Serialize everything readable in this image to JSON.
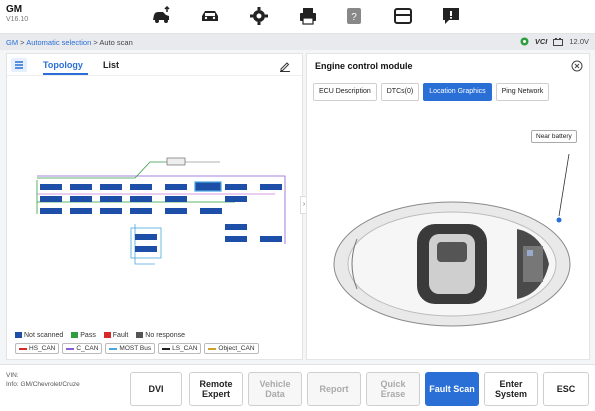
{
  "app": {
    "make": "GM",
    "version": "V16.10"
  },
  "toolbar": {
    "icons": [
      "car-upload-icon",
      "car-icon",
      "gear-icon",
      "printer-icon",
      "help-icon",
      "folder-icon",
      "feedback-icon"
    ]
  },
  "breadcrumb": {
    "part1": "GM",
    "sep1": " > ",
    "part2": "Automatic selection",
    "sep2": " > ",
    "part3": "Auto scan"
  },
  "status": {
    "vci": "VCI",
    "voltage": "12.0V"
  },
  "left_panel": {
    "tab_topology": "Topology",
    "tab_list": "List",
    "legend": {
      "not_scanned": "Not scanned",
      "pass": "Pass",
      "fault": "Fault",
      "no_response": "No response",
      "buses": [
        "HS_CAN",
        "C_CAN",
        "MOST Bus",
        "LS_CAN",
        "Object_CAN"
      ]
    }
  },
  "right_panel": {
    "title": "Engine control module",
    "tabs": [
      "ECU Description",
      "DTCs(0)",
      "Location Graphics",
      "Ping Network"
    ],
    "active_tab": "Location Graphics",
    "callout": "Near battery"
  },
  "bottom": {
    "vin_label": "VIN:",
    "info": "Info: GM/Chevrolet/Cruze",
    "buttons": {
      "dvi": "DVI",
      "remote_expert_1": "Remote",
      "remote_expert_2": "Expert",
      "vehicle_data_1": "Vehicle",
      "vehicle_data_2": "Data",
      "report": "Report",
      "quick_erase_1": "Quick",
      "quick_erase_2": "Erase",
      "fault_scan": "Fault Scan",
      "enter_system_1": "Enter",
      "enter_system_2": "System",
      "esc": "ESC"
    }
  },
  "colors": {
    "accent": "#2a6fd6",
    "pass": "#2e9e3e",
    "fault": "#d62a2a",
    "no_response": "#555555",
    "not_scanned": "#1e4fa8"
  }
}
